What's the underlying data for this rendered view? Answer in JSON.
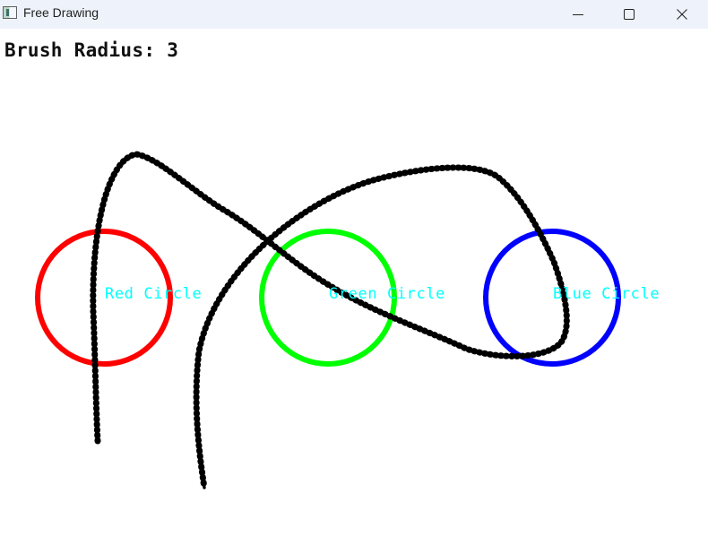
{
  "window": {
    "title": "Free Drawing",
    "icons": {
      "app": "app-icon",
      "minimize": "minimize-icon",
      "maximize": "maximize-icon",
      "close": "close-icon"
    }
  },
  "status": {
    "brush_radius_text": "Brush Radius: 3",
    "brush_radius": 3
  },
  "circles": [
    {
      "label": "Red Circle",
      "color": "#ff0000",
      "label_color": "#00ffff"
    },
    {
      "label": "Green Circle",
      "color": "#00ff00",
      "label_color": "#00ffff"
    },
    {
      "label": "Blue Circle",
      "color": "#0000ff",
      "label_color": "#00ffff"
    }
  ],
  "strokes": [
    {
      "name": "stroke-1",
      "color": "#000000"
    },
    {
      "name": "stroke-2",
      "color": "#000000"
    }
  ]
}
